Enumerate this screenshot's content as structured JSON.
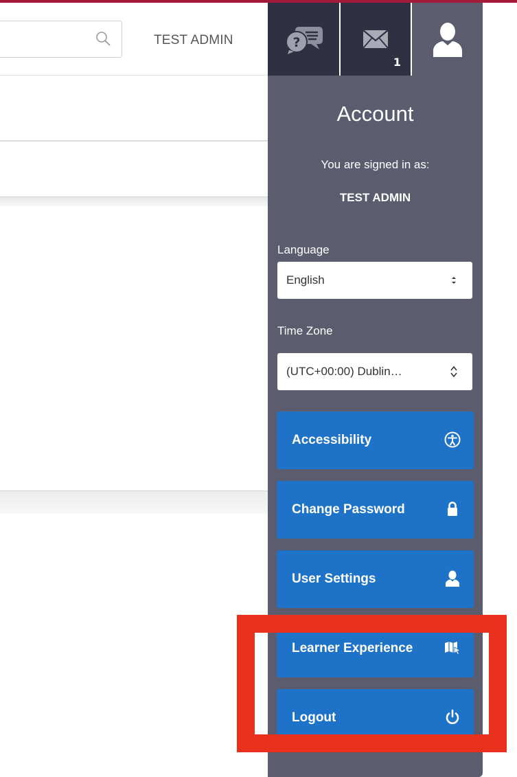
{
  "header": {
    "admin_name": "TEST ADMIN"
  },
  "tabs": {
    "mail_badge": "1"
  },
  "account": {
    "title": "Account",
    "signed_in_label": "You are signed in as:",
    "signed_in_user": "TEST ADMIN",
    "language_label": "Language",
    "language_value": "English",
    "timezone_label": "Time Zone",
    "timezone_value": "(UTC+00:00) Dublin…",
    "actions": [
      {
        "label": "Accessibility",
        "icon": "accessibility-icon"
      },
      {
        "label": "Change Password",
        "icon": "lock-icon"
      },
      {
        "label": "User Settings",
        "icon": "user-icon"
      },
      {
        "label": "Learner Experience",
        "icon": "map-cursor-icon"
      },
      {
        "label": "Logout",
        "icon": "power-icon"
      }
    ]
  },
  "colors": {
    "panel": "#5b5c6e",
    "tab_dark": "#2f3142",
    "action_blue": "#1e73c8",
    "highlight_red": "#e8301c",
    "top_accent": "#a31a3a"
  }
}
